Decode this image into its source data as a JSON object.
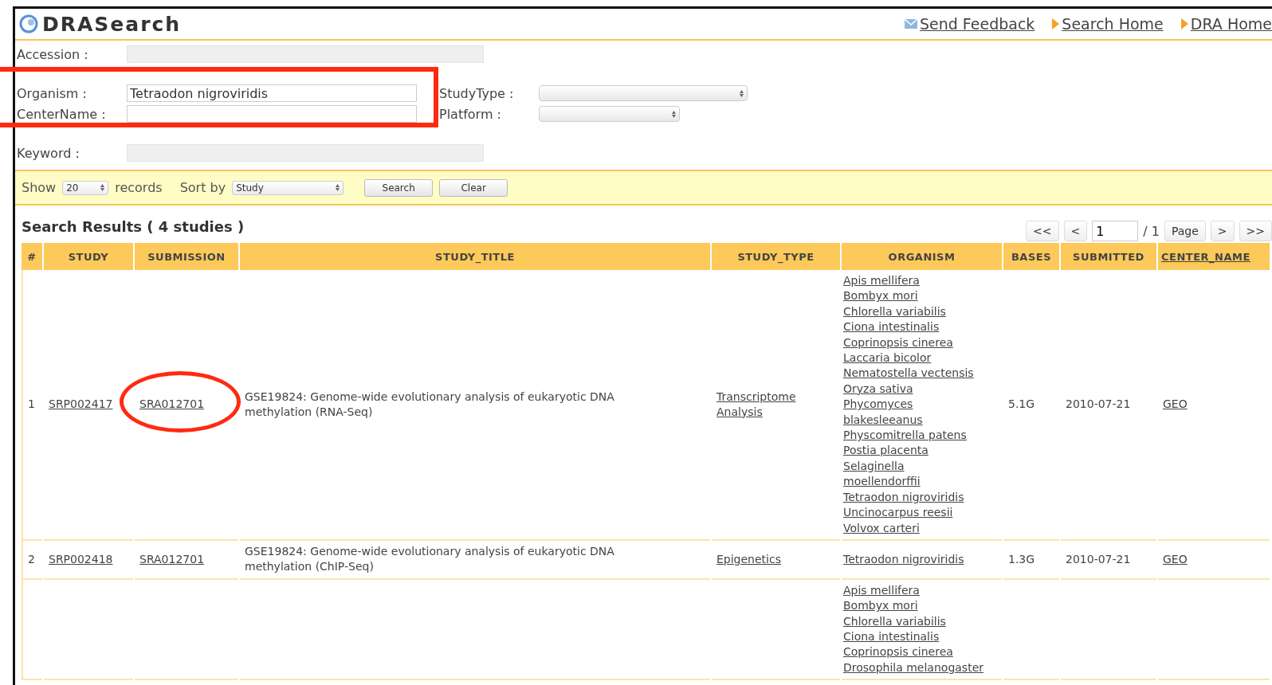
{
  "header": {
    "logo": "DRASearch",
    "links": [
      {
        "kind": "mail",
        "label": "Send Feedback"
      },
      {
        "kind": "arrow",
        "label": "Search Home"
      },
      {
        "kind": "arrow",
        "label": "DRA Home"
      }
    ]
  },
  "form": {
    "accession": {
      "label": "Accession :"
    },
    "organism": {
      "label": "Organism :",
      "value": "Tetraodon nigroviridis"
    },
    "center_name": {
      "label": "CenterName :"
    },
    "study_type": {
      "label": "StudyType :"
    },
    "platform": {
      "label": "Platform :"
    },
    "keyword": {
      "label": "Keyword :"
    }
  },
  "filter_bar": {
    "show_label": "Show",
    "show_value": "20",
    "records_label": "records",
    "sort_label": "Sort by",
    "sort_value": "Study",
    "buttons": [
      "Search",
      "Clear"
    ]
  },
  "results": {
    "title": "Search Results ( 4 studies )",
    "pagination": {
      "first": "<<",
      "prev": "<",
      "page_value": "1",
      "total": "/ 1",
      "page_button": "Page",
      "next": ">",
      "last": ">>"
    },
    "columns": [
      {
        "label": "#",
        "link": false
      },
      {
        "label": "STUDY",
        "link": false
      },
      {
        "label": "SUBMISSION",
        "link": false
      },
      {
        "label": "STUDY_TITLE",
        "link": false
      },
      {
        "label": "STUDY_TYPE",
        "link": false
      },
      {
        "label": "ORGANISM",
        "link": false
      },
      {
        "label": "BASES",
        "link": false
      },
      {
        "label": "SUBMITTED",
        "link": false
      },
      {
        "label": "CENTER_NAME",
        "link": true
      }
    ],
    "rows": [
      {
        "num": "1",
        "study": "SRP002417",
        "submission": "SRA012701",
        "title": "GSE19824: Genome-wide evolutionary analysis of eukaryotic DNA methylation (RNA-Seq)",
        "study_type": "Transcriptome Analysis",
        "organisms": [
          "Apis mellifera",
          "Bombyx mori",
          "Chlorella variabilis",
          "Ciona intestinalis",
          "Coprinopsis cinerea",
          "Laccaria bicolor",
          "Nematostella vectensis",
          "Oryza sativa",
          "Phycomyces blakesleeanus",
          "Physcomitrella patens",
          "Postia placenta",
          "Selaginella moellendorffii",
          "Tetraodon nigroviridis",
          "Uncinocarpus reesii",
          "Volvox carteri"
        ],
        "bases": "5.1G",
        "submitted": "2010-07-21",
        "center_name": "GEO"
      },
      {
        "num": "2",
        "study": "SRP002418",
        "submission": "SRA012701",
        "title": "GSE19824: Genome-wide evolutionary analysis of eukaryotic DNA methylation (ChIP-Seq)",
        "study_type": "Epigenetics",
        "organisms": [
          "Tetraodon nigroviridis"
        ],
        "bases": "1.3G",
        "submitted": "2010-07-21",
        "center_name": "GEO"
      },
      {
        "organisms": [
          "Apis mellifera",
          "Bombyx mori",
          "Chlorella variabilis",
          "Ciona intestinalis",
          "Coprinopsis cinerea",
          "Drosophila melanogaster"
        ]
      }
    ]
  },
  "annotations": [
    {
      "kind": "rectangle"
    },
    {
      "kind": "ellipse"
    }
  ]
}
